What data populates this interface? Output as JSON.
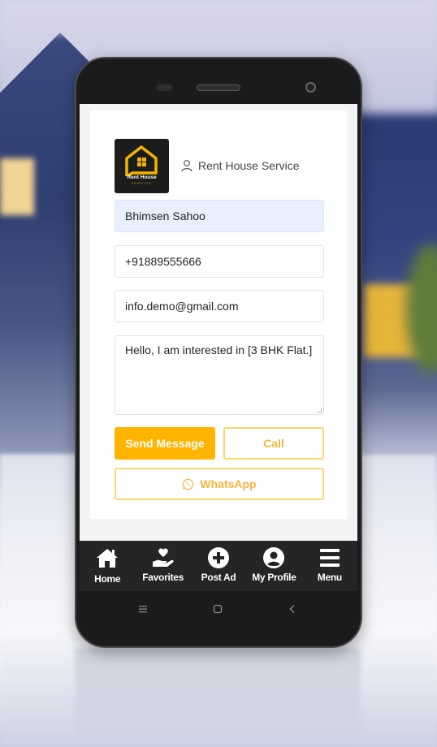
{
  "background": {
    "description": "blurred house exterior"
  },
  "brand": {
    "logo_text": "Rent House",
    "logo_subtext": "SERVICE",
    "name": "Rent House Service",
    "icon": "user-icon"
  },
  "form": {
    "name_value": "Bhimsen Sahoo",
    "phone_value": "+91889555666",
    "email_value": "info.demo@gmail.com",
    "message_value": "Hello, I am interested in [3 BHK Flat.]"
  },
  "buttons": {
    "send_label": "Send Message",
    "call_label": "Call",
    "whatsapp_label": "WhatsApp",
    "whatsapp_icon": "whatsapp-icon"
  },
  "bottom_nav": {
    "items": [
      {
        "label": "Home",
        "icon": "home-icon"
      },
      {
        "label": "Favorites",
        "icon": "heart-hand-icon"
      },
      {
        "label": "Post Ad",
        "icon": "plus-circle-icon"
      },
      {
        "label": "My Profile",
        "icon": "user-circle-icon"
      },
      {
        "label": "Menu",
        "icon": "hamburger-icon"
      }
    ]
  },
  "system_nav": {
    "recents_glyph": "≡",
    "home_glyph": "▢",
    "back_glyph": "‹"
  },
  "colors": {
    "accent": "#ffb400",
    "accent_outline": "#ffd56a",
    "accent_text": "#f5b43c",
    "nav_bg": "#252525",
    "field_filled_bg": "#e8f0fe"
  }
}
